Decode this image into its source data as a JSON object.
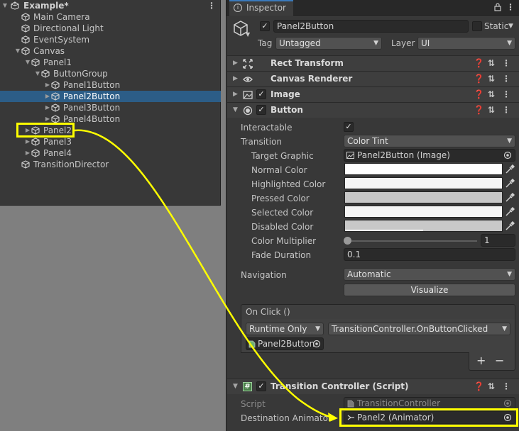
{
  "hierarchy": {
    "scene_title": "Example*",
    "items": [
      {
        "label": "Main Camera",
        "depth": 1,
        "arrow": ""
      },
      {
        "label": "Directional Light",
        "depth": 1,
        "arrow": ""
      },
      {
        "label": "EventSystem",
        "depth": 1,
        "arrow": ""
      },
      {
        "label": "Canvas",
        "depth": 1,
        "arrow": "▼"
      },
      {
        "label": "Panel1",
        "depth": 2,
        "arrow": "▼"
      },
      {
        "label": "ButtonGroup",
        "depth": 3,
        "arrow": "▼"
      },
      {
        "label": "Panel1Button",
        "depth": 4,
        "arrow": "▶"
      },
      {
        "label": "Panel2Button",
        "depth": 4,
        "arrow": "▶",
        "selected": true
      },
      {
        "label": "Panel3Button",
        "depth": 4,
        "arrow": "▶"
      },
      {
        "label": "Panel4Button",
        "depth": 4,
        "arrow": "▶"
      },
      {
        "label": "Panel2",
        "depth": 2,
        "arrow": "▶",
        "highlighted": true
      },
      {
        "label": "Panel3",
        "depth": 2,
        "arrow": "▶"
      },
      {
        "label": "Panel4",
        "depth": 2,
        "arrow": "▶"
      },
      {
        "label": "TransitionDirector",
        "depth": 1,
        "arrow": ""
      }
    ]
  },
  "inspector": {
    "tab_label": "Inspector",
    "object_name": "Panel2Button",
    "static_label": "Static",
    "tag_label": "Tag",
    "tag_value": "Untagged",
    "layer_label": "Layer",
    "layer_value": "UI",
    "components": {
      "rect_transform": "Rect Transform",
      "canvas_renderer": "Canvas Renderer",
      "image": "Image",
      "button": "Button",
      "transition_controller": "Transition Controller (Script)"
    },
    "button": {
      "interactable_label": "Interactable",
      "transition_label": "Transition",
      "transition_value": "Color Tint",
      "target_graphic_label": "Target Graphic",
      "target_graphic_value": "Panel2Button (Image)",
      "normal_color_label": "Normal Color",
      "highlighted_color_label": "Highlighted Color",
      "pressed_color_label": "Pressed Color",
      "selected_color_label": "Selected Color",
      "disabled_color_label": "Disabled Color",
      "color_multiplier_label": "Color Multiplier",
      "color_multiplier_value": "1",
      "fade_duration_label": "Fade Duration",
      "fade_duration_value": "0.1",
      "navigation_label": "Navigation",
      "navigation_value": "Automatic",
      "visualize_label": "Visualize",
      "onclick_label": "On Click ()",
      "runtime_value": "Runtime Only",
      "function_value": "TransitionController.OnButtonClicked",
      "object_value": "Panel2Button",
      "add_label": "+",
      "remove_label": "−"
    },
    "transition_controller": {
      "script_label": "Script",
      "script_value": "TransitionController",
      "dest_label": "Destination Animator",
      "dest_value": "Panel2 (Animator)"
    }
  },
  "colors": {
    "highlight": "#ffff00",
    "selection": "#2c5d87",
    "normal_color": "#ffffff",
    "highlighted_color": "#f5f5f5",
    "pressed_color": "#c8c8c8",
    "selected_color": "#f5f5f5",
    "disabled_color": "#c8c8c8"
  }
}
